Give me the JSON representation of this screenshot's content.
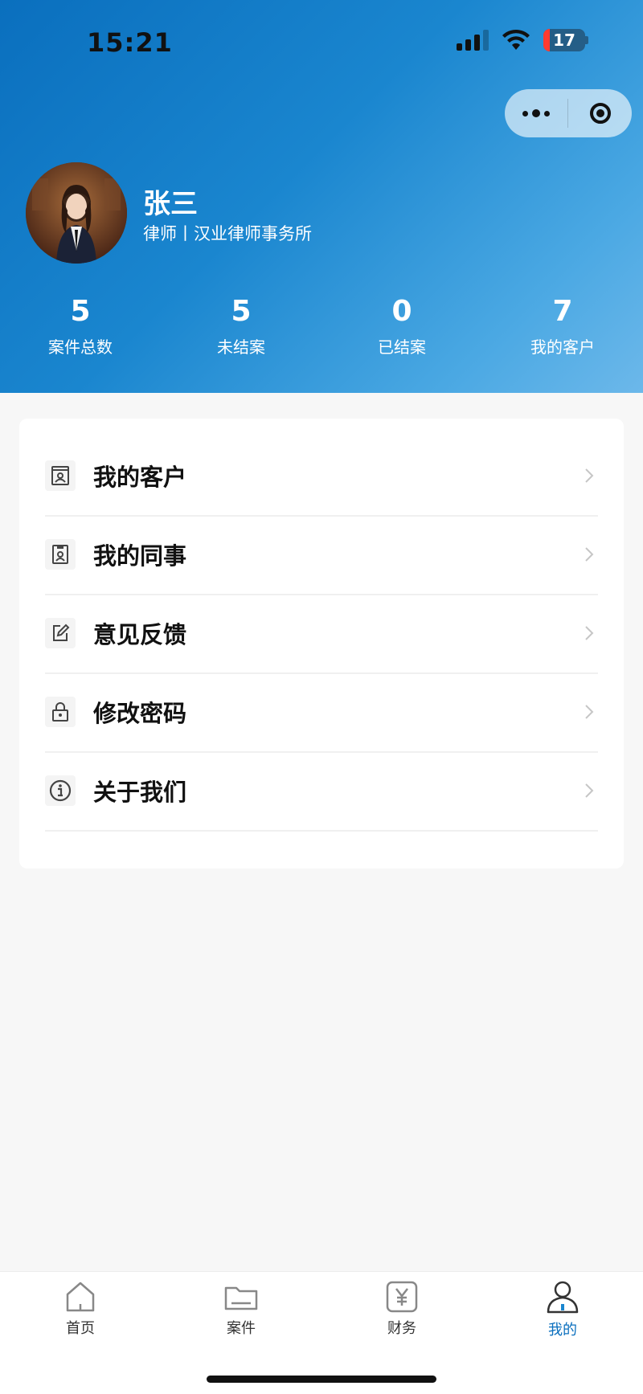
{
  "status_bar": {
    "time": "15:21",
    "battery": "17"
  },
  "profile": {
    "name": "张三",
    "subtitle": "律师丨汉业律师事务所"
  },
  "stats": [
    {
      "value": "5",
      "label": "案件总数"
    },
    {
      "value": "5",
      "label": "未结案"
    },
    {
      "value": "0",
      "label": "已结案"
    },
    {
      "value": "7",
      "label": "我的客户"
    }
  ],
  "menu": [
    {
      "label": "我的客户",
      "icon": "contact-card-icon"
    },
    {
      "label": "我的同事",
      "icon": "colleague-badge-icon"
    },
    {
      "label": "意见反馈",
      "icon": "edit-icon"
    },
    {
      "label": "修改密码",
      "icon": "lock-icon"
    },
    {
      "label": "关于我们",
      "icon": "info-icon"
    }
  ],
  "tabbar": [
    {
      "label": "首页",
      "icon": "home-icon"
    },
    {
      "label": "案件",
      "icon": "folder-icon"
    },
    {
      "label": "财务",
      "icon": "yen-icon"
    },
    {
      "label": "我的",
      "icon": "user-icon",
      "active": true
    }
  ],
  "colors": {
    "primary": "#0a6fbe",
    "header_gradient_end": "#6cb8ea",
    "background": "#f7f7f7"
  }
}
